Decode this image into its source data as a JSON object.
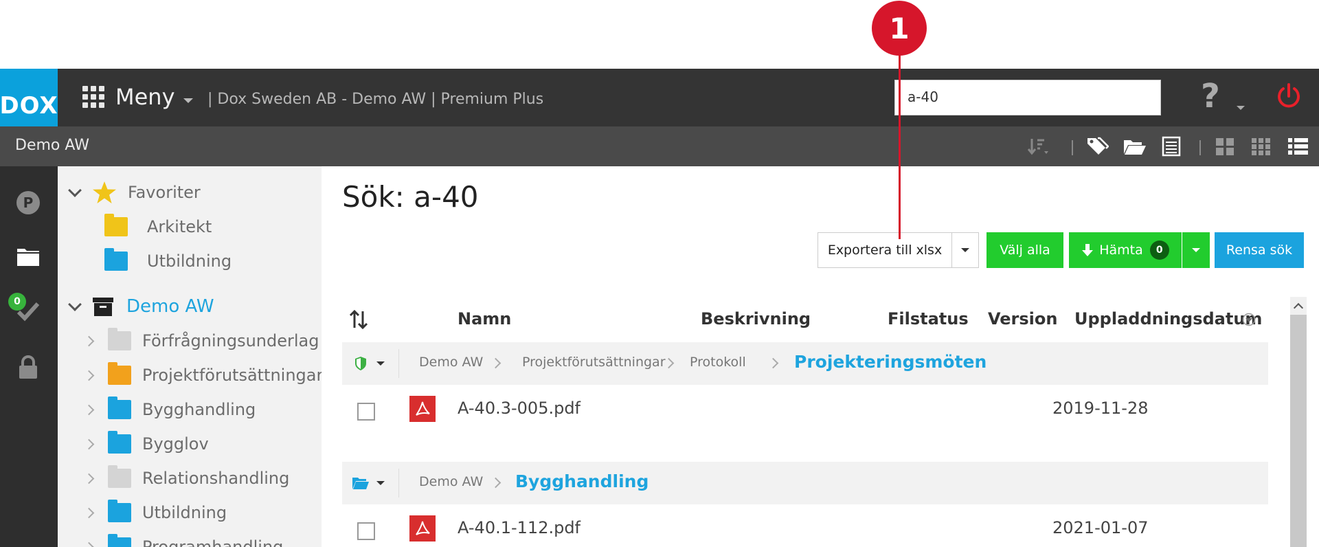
{
  "annotation": {
    "number": "1"
  },
  "topbar": {
    "logo": "DOX",
    "menu_label": "Meny",
    "company": "| Dox Sweden AB - Demo AW | Premium Plus",
    "search_value": "a-40",
    "help": "?"
  },
  "subbar": {
    "title": "Demo AW"
  },
  "rail": {
    "badge": "0"
  },
  "tree": {
    "favorites": "Favoriter",
    "fav_items": [
      "Arkitekt",
      "Utbildning"
    ],
    "project": "Demo AW",
    "folders": [
      "Förfrågningsunderlag",
      "Projektförutsättningar",
      "Bygghandling",
      "Bygglov",
      "Relationshandling",
      "Utbildning",
      "Programhandling"
    ]
  },
  "main": {
    "title": "Sök: a-40",
    "buttons": {
      "export": "Exportera till xlsx",
      "select_all": "Välj alla",
      "download": "Hämta",
      "download_count": "0",
      "clear": "Rensa sök"
    },
    "columns": [
      "Namn",
      "Beskrivning",
      "Filstatus",
      "Version",
      "Uppladdningsdatum"
    ],
    "groups": [
      {
        "path": [
          "Demo AW",
          "Projektförutsättningar",
          "Protokoll"
        ],
        "final": "Projekteringsmöten",
        "file": {
          "name": "A-40.3-005.pdf",
          "date": "2019-11-28"
        }
      },
      {
        "path": [
          "Demo AW"
        ],
        "final": "Bygghandling",
        "file": {
          "name": "A-40.1-112.pdf",
          "date": "2021-01-07"
        }
      }
    ]
  },
  "colors": {
    "accent_blue": "#1ba3de",
    "green": "#22cc2e",
    "annotation_red": "#d6162b"
  }
}
